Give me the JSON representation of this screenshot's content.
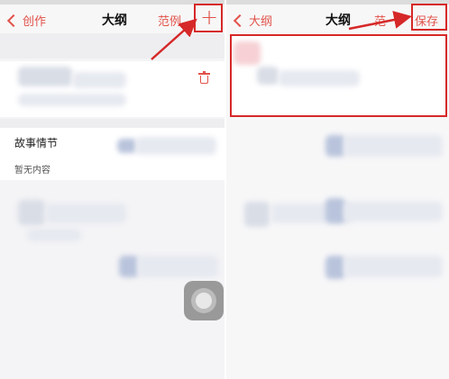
{
  "left": {
    "nav": {
      "back_label": "创作",
      "title": "大纲",
      "example_label": "范例",
      "add_label": "+"
    },
    "sections": [
      {
        "title": "故事情节",
        "empty_text": "暂无内容"
      }
    ]
  },
  "right": {
    "nav": {
      "back_label": "大纲",
      "title": "大纲",
      "example_label": "范",
      "save_label": "保存"
    }
  },
  "colors": {
    "accent": "#e2524a",
    "highlight_red": "#d62828"
  },
  "icons": [
    "chevron-left-icon",
    "plus-icon",
    "trash-icon",
    "arrow-annotation-icon",
    "assistive-touch-icon"
  ]
}
